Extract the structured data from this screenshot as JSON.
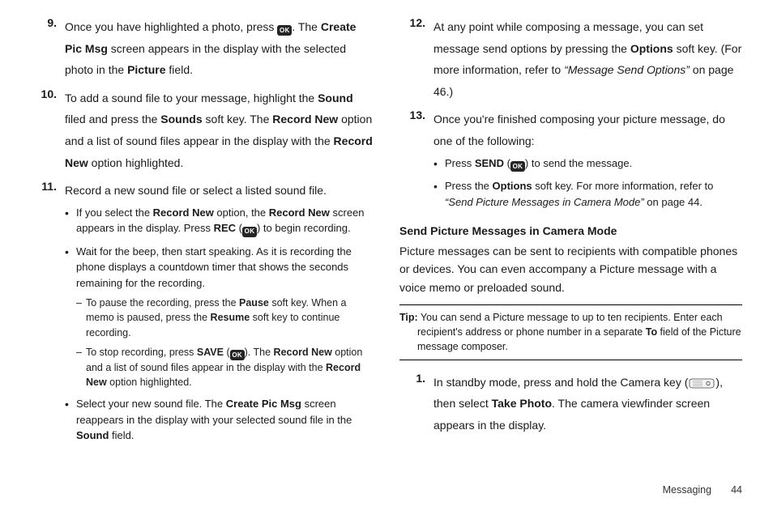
{
  "left": {
    "items": [
      {
        "num": "9.",
        "parts": [
          "Once you have highlighted a photo, press ",
          {
            "icon": "ok"
          },
          ". The ",
          {
            "b": "Create Pic Msg"
          },
          " screen appears in the display with the selected photo in the ",
          {
            "b": "Picture"
          },
          " field."
        ]
      },
      {
        "num": "10.",
        "parts": [
          "To add a sound file to your message, highlight the ",
          {
            "b": "Sound"
          },
          " filed and press the ",
          {
            "b": "Sounds"
          },
          " soft key. The ",
          {
            "b": "Record New"
          },
          " option and a list of sound files appear in the display with the ",
          {
            "b": "Record New"
          },
          " option highlighted."
        ]
      },
      {
        "num": "11.",
        "parts": [
          "Record a new sound file or select a listed sound file."
        ],
        "bullets": [
          {
            "parts": [
              "If you select the ",
              {
                "b": "Record New"
              },
              " option, the ",
              {
                "b": "Record New"
              },
              " screen appears in the display. Press ",
              {
                "b": "REC"
              },
              " (",
              {
                "icon": "ok"
              },
              ") to begin recording."
            ]
          },
          {
            "parts": [
              "Wait for the beep, then start speaking. As it is recording the phone displays a countdown timer that shows the seconds remaining for the recording."
            ],
            "dashes": [
              {
                "parts": [
                  "To pause the recording, press the ",
                  {
                    "b": "Pause"
                  },
                  " soft key. When a memo is paused, press the ",
                  {
                    "b": "Resume"
                  },
                  " soft key to continue recording."
                ]
              },
              {
                "parts": [
                  "To stop recording, press ",
                  {
                    "b": "SAVE"
                  },
                  " (",
                  {
                    "icon": "ok"
                  },
                  "). The ",
                  {
                    "b": "Record New"
                  },
                  " option and a list of sound files appear in the display with the ",
                  {
                    "b": "Record New"
                  },
                  " option highlighted."
                ]
              }
            ]
          },
          {
            "parts": [
              "Select your new sound file. The ",
              {
                "b": "Create Pic Msg"
              },
              " screen reappears in the display with your selected sound file in the ",
              {
                "b": "Sound"
              },
              " field."
            ]
          }
        ]
      }
    ]
  },
  "right": {
    "items": [
      {
        "num": "12.",
        "parts": [
          "At any point while composing a message, you can set message send options by pressing the ",
          {
            "b": "Options"
          },
          " soft key. (For more information, refer to ",
          {
            "iq": "“Message Send Options”"
          },
          " on page 46.)"
        ]
      },
      {
        "num": "13.",
        "parts": [
          "Once you're finished composing your picture message, do one of the following:"
        ],
        "bullets": [
          {
            "parts": [
              "Press ",
              {
                "b": "SEND"
              },
              " (",
              {
                "icon": "ok"
              },
              ") to send the message."
            ]
          },
          {
            "parts": [
              "Press the ",
              {
                "b": "Options"
              },
              " soft key. For more information, refer to ",
              {
                "iq": "“Send Picture Messages in Camera Mode”"
              },
              "  on page 44."
            ]
          }
        ]
      }
    ],
    "heading": "Send Picture Messages in Camera Mode",
    "para": "Picture messages can be sent to recipients with compatible phones or devices. You can even accompany a Picture message with a voice memo or preloaded sound.",
    "tip": {
      "label": "Tip:",
      "parts": [
        " You can send a Picture message to up to ten recipients. Enter each recipient's address or phone number in a separate ",
        {
          "b": "To"
        },
        " field of the Picture message composer."
      ]
    },
    "steps": [
      {
        "num": "1.",
        "parts": [
          "In standby mode, press and hold the Camera key (",
          {
            "icon": "camera"
          },
          "), then select ",
          {
            "b": "Take Photo"
          },
          ". The camera viewfinder screen appears in the display."
        ]
      }
    ]
  },
  "footer": {
    "section": "Messaging",
    "page": "44"
  }
}
